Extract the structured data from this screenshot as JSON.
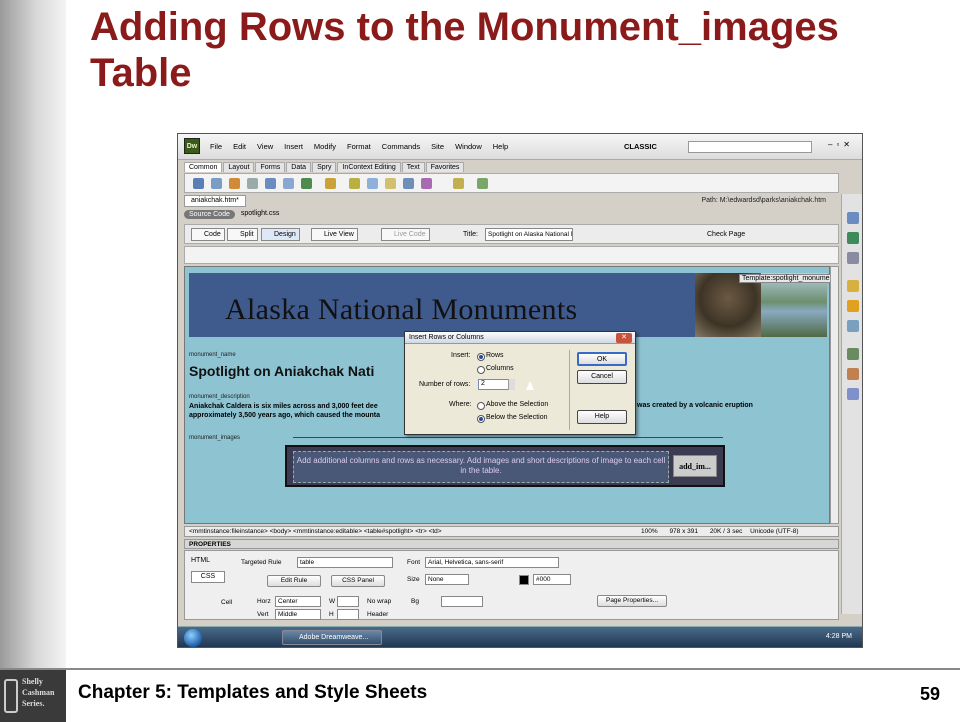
{
  "slide": {
    "title": "Adding Rows to the Monument_images Table",
    "footer": "Chapter 5: Templates and Style Sheets",
    "page_number": "59",
    "logo_lines": [
      "Shelly",
      "Cashman",
      "Series."
    ]
  },
  "app": {
    "logo": "Dw",
    "menus": [
      "File",
      "Edit",
      "View",
      "Insert",
      "Modify",
      "Format",
      "Commands",
      "Site",
      "Window",
      "Help"
    ],
    "workspace": "CLASSIC",
    "insert_tabs": [
      "Common",
      "Layout",
      "Forms",
      "Data",
      "Spry",
      "InContext Editing",
      "Text",
      "Favorites"
    ],
    "document_tab": "aniakchak.htm*",
    "path": "Path: M:\\edwardsd\\parks\\aniakchak.htm",
    "source_code": "Source Code",
    "related_file": "spotlight.css",
    "view_buttons": [
      "Code",
      "Split",
      "Design",
      "Live View",
      "Live Code"
    ],
    "title_label": "Title:",
    "title_value": "Spotlight on Alaska National Mo",
    "check_page": "Check Page"
  },
  "page": {
    "template_tag": "Template:spotlight_monume",
    "banner_title": "Alaska National Monuments",
    "monument_name_label": "monument_name",
    "spotlight_heading": "Spotlight on Aniakchak Nati",
    "monument_description_label": "monument_description",
    "desc_line1": "Aniakchak Caldera is six miles across and 3,000 feet dee",
    "desc_line2": "approximately 3,500 years ago, which caused the mounta",
    "desc_right": "was created by a volcanic eruption",
    "monument_images_label": "monument_images",
    "image_cell_text": "Add additional columns and rows as necessary. Add images and short descriptions of image to each cell in the table.",
    "add_image_label": "add_im..."
  },
  "dialog": {
    "title": "Insert Rows or Columns",
    "close": "✕",
    "insert_label": "Insert:",
    "opt_rows": "Rows",
    "opt_columns": "Columns",
    "rows_label": "Number of rows:",
    "rows_value": "2",
    "where_label": "Where:",
    "opt_above": "Above the Selection",
    "opt_below": "Below the Selection",
    "ok": "OK",
    "cancel": "Cancel",
    "help": "Help"
  },
  "status": {
    "tag_path": "<mmtinstance:fileinstance> <body> <mmtinstance:editable> <table#spotlight> <tr> <td>",
    "zoom": "100%",
    "size": "978 x 391",
    "download": "20K / 3 sec",
    "encoding": "Unicode (UTF-8)"
  },
  "properties": {
    "header": "PROPERTIES",
    "html": "HTML",
    "css": "CSS",
    "targeted_rule_label": "Targeted Rule",
    "targeted_rule": "table",
    "edit_rule": "Edit Rule",
    "css_panel": "CSS Panel",
    "font_label": "Font",
    "font_value": "Arial, Helvetica, sans-serif",
    "size_label": "Size",
    "size_value": "None",
    "color_value": "#000",
    "cell_label": "Cell",
    "horz_label": "Horz",
    "horz_value": "Center",
    "vert_label": "Vert",
    "vert_value": "Middle",
    "w_label": "W",
    "h_label": "H",
    "nowrap_label": "No wrap",
    "header_label": "Header",
    "bg_label": "Bg",
    "page_properties": "Page Properties..."
  },
  "taskbar": {
    "item": "Adobe Dreamweave...",
    "clock": "4:28 PM"
  },
  "colors": {
    "title_red": "#8b1a1a",
    "design_bg": "#8ec3d2",
    "banner_bg": "#3f5a8c"
  }
}
